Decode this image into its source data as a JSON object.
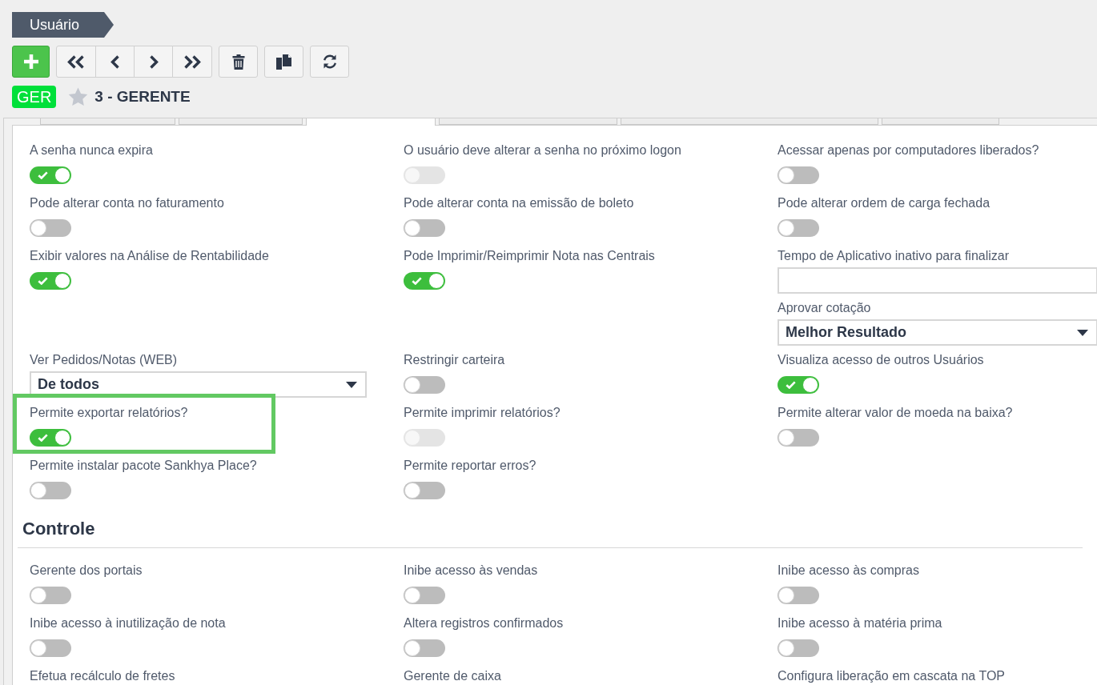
{
  "header": {
    "title": "Usuário"
  },
  "record": {
    "badge": "GER",
    "favorite": false,
    "name": "3 - GERENTE"
  },
  "tabs": [
    {
      "selected": false
    },
    {
      "selected": false
    },
    {
      "selected": true
    },
    {
      "selected": false
    },
    {
      "selected": false
    },
    {
      "selected": false
    }
  ],
  "sections": [
    {
      "rows": [
        {
          "cells": [
            {
              "fields": [
                {
                  "kind": "toggle",
                  "label": "A senha nunca expira",
                  "on": true,
                  "disabled": false,
                  "highlighted": false
                }
              ]
            },
            {
              "fields": [
                {
                  "kind": "toggle",
                  "label": "O usuário deve alterar a senha no próximo logon",
                  "on": false,
                  "disabled": true,
                  "highlighted": false
                }
              ]
            },
            {
              "fields": [
                {
                  "kind": "toggle",
                  "label": "Acessar apenas por computadores liberados?",
                  "on": false,
                  "disabled": false,
                  "highlighted": false
                }
              ]
            }
          ]
        },
        {
          "cells": [
            {
              "fields": [
                {
                  "kind": "toggle",
                  "label": "Pode alterar conta no faturamento",
                  "on": false,
                  "disabled": false,
                  "highlighted": false
                }
              ]
            },
            {
              "fields": [
                {
                  "kind": "toggle",
                  "label": "Pode alterar conta na emissão de boleto",
                  "on": false,
                  "disabled": false,
                  "highlighted": false
                }
              ]
            },
            {
              "fields": [
                {
                  "kind": "toggle",
                  "label": "Pode alterar ordem de carga fechada",
                  "on": false,
                  "disabled": false,
                  "highlighted": false
                }
              ]
            }
          ]
        },
        {
          "cells": [
            {
              "fields": [
                {
                  "kind": "toggle",
                  "label": "Exibir valores na Análise de Rentabilidade",
                  "on": true,
                  "disabled": false,
                  "highlighted": false
                }
              ]
            },
            {
              "fields": [
                {
                  "kind": "toggle",
                  "label": "Pode Imprimir/Reimprimir Nota nas Centrais",
                  "on": true,
                  "disabled": false,
                  "highlighted": false
                }
              ]
            },
            {
              "fields": [
                {
                  "kind": "text",
                  "label": "Tempo de Aplicativo inativo para finalizar",
                  "highlighted": false
                },
                {
                  "kind": "select",
                  "label": "Aprovar cotação",
                  "value": "Melhor Resultado",
                  "highlighted": false
                }
              ]
            }
          ]
        },
        {
          "cells": [
            {
              "fields": [
                {
                  "kind": "select",
                  "label": "Ver Pedidos/Notas (WEB)",
                  "value": "De todos",
                  "highlighted": false
                }
              ]
            },
            {
              "fields": [
                {
                  "kind": "toggle",
                  "label": "Restringir carteira",
                  "on": false,
                  "disabled": false,
                  "highlighted": false
                }
              ]
            },
            {
              "fields": [
                {
                  "kind": "toggle",
                  "label": "Visualiza acesso de outros Usuários",
                  "on": true,
                  "disabled": false,
                  "highlighted": false
                }
              ]
            }
          ]
        },
        {
          "cells": [
            {
              "fields": [
                {
                  "kind": "toggle",
                  "label": "Permite exportar relatórios?",
                  "on": true,
                  "disabled": false,
                  "highlighted": true
                }
              ]
            },
            {
              "fields": [
                {
                  "kind": "toggle",
                  "label": "Permite imprimir relatórios?",
                  "on": false,
                  "disabled": true,
                  "highlighted": false
                }
              ]
            },
            {
              "fields": [
                {
                  "kind": "toggle",
                  "label": "Permite alterar valor de moeda na baixa?",
                  "on": false,
                  "disabled": false,
                  "highlighted": false
                }
              ]
            }
          ]
        },
        {
          "cells": [
            {
              "fields": [
                {
                  "kind": "toggle",
                  "label": "Permite instalar pacote Sankhya Place?",
                  "on": false,
                  "disabled": false,
                  "highlighted": false
                }
              ]
            },
            {
              "fields": [
                {
                  "kind": "toggle",
                  "label": "Permite reportar erros?",
                  "on": false,
                  "disabled": false,
                  "highlighted": false
                }
              ]
            }
          ]
        }
      ]
    },
    {
      "heading": "Controle",
      "rows": [
        {
          "cells": [
            {
              "fields": [
                {
                  "kind": "toggle",
                  "label": "Gerente dos portais",
                  "on": false,
                  "disabled": false,
                  "highlighted": false
                }
              ]
            },
            {
              "fields": [
                {
                  "kind": "toggle",
                  "label": "Inibe acesso às vendas",
                  "on": false,
                  "disabled": false,
                  "highlighted": false
                }
              ]
            },
            {
              "fields": [
                {
                  "kind": "toggle",
                  "label": "Inibe acesso às compras",
                  "on": false,
                  "disabled": false,
                  "highlighted": false
                }
              ]
            }
          ]
        },
        {
          "cells": [
            {
              "fields": [
                {
                  "kind": "toggle",
                  "label": "Inibe acesso à inutilização de nota",
                  "on": false,
                  "disabled": false,
                  "highlighted": false
                }
              ]
            },
            {
              "fields": [
                {
                  "kind": "toggle",
                  "label": "Altera registros confirmados",
                  "on": false,
                  "disabled": false,
                  "highlighted": false
                }
              ]
            },
            {
              "fields": [
                {
                  "kind": "toggle",
                  "label": "Inibe acesso à matéria prima",
                  "on": false,
                  "disabled": false,
                  "highlighted": false
                }
              ]
            }
          ]
        },
        {
          "cells": [
            {
              "fields": [
                {
                  "kind": "toggle",
                  "label": "Efetua recálculo de fretes",
                  "highlighted": false
                }
              ]
            },
            {
              "fields": [
                {
                  "kind": "toggle",
                  "label": "Gerente de caixa",
                  "highlighted": false
                }
              ]
            },
            {
              "fields": [
                {
                  "kind": "toggle",
                  "label": "Configura liberação em cascata na TOP",
                  "highlighted": false
                }
              ]
            }
          ]
        }
      ]
    }
  ]
}
